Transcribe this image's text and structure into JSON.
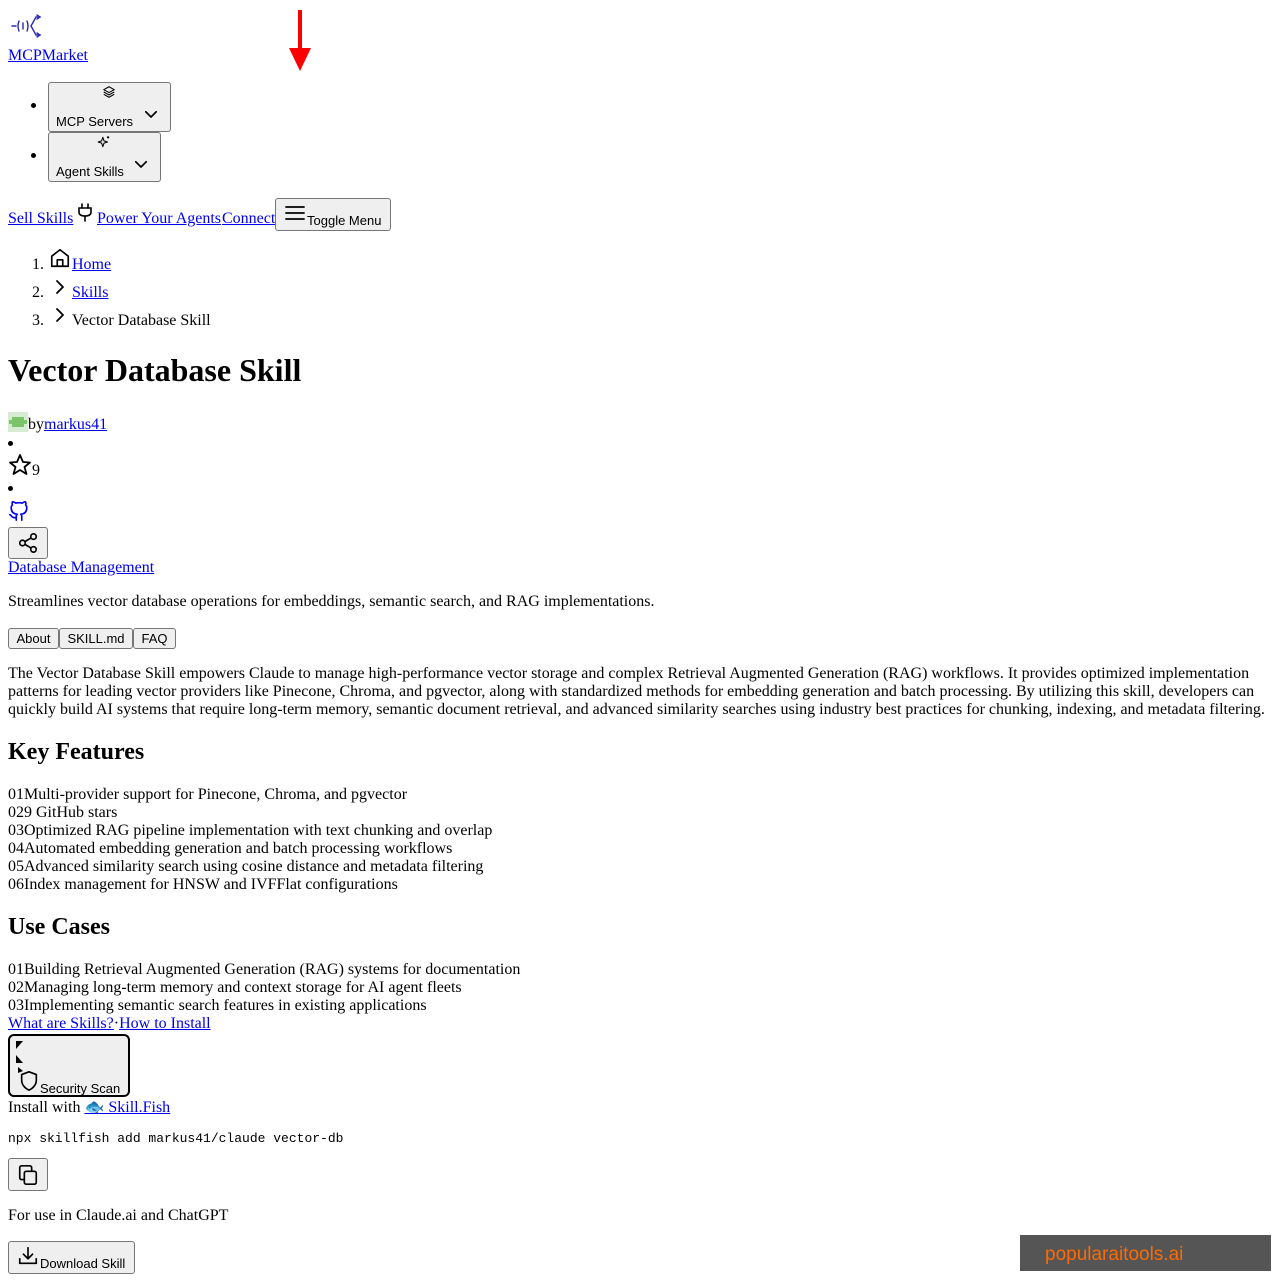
{
  "brand": {
    "name": "MCPMarket"
  },
  "nav": {
    "menus": [
      {
        "label": "MCP Servers",
        "icon": "layers-icon"
      },
      {
        "label": "Agent Skills",
        "icon": "sparkles-icon"
      }
    ],
    "sell_skills": "Sell Skills",
    "power_agents": "Power Your Agents",
    "connect": "Connect",
    "toggle_menu": "Toggle Menu"
  },
  "breadcrumb": {
    "items": [
      {
        "num": "1.",
        "label": "Home"
      },
      {
        "num": "2.",
        "label": "Skills"
      },
      {
        "num": "3.",
        "label": "Vector Database Skill"
      }
    ]
  },
  "page": {
    "title": "Vector Database Skill",
    "by": "by",
    "author": "markus41",
    "stars": "9",
    "category": "Database Management",
    "summary": "Streamlines vector database operations for embeddings, semantic search, and RAG implementations."
  },
  "tabs": [
    "About",
    "SKILL.md",
    "FAQ"
  ],
  "about": {
    "lines": [
      "The Vector Database Skill empowers Claude to manage high-performance vector storage and complex Retrieval Augmented Generation (RAG) workflows. It provides optimized implementation",
      "patterns for leading vector providers like Pinecone, Chroma, and pgvector, along with standardized methods for embedding generation and batch processing. By utilizing this skill, developers can",
      "quickly build AI systems that require long-term memory, semantic document retrieval, and advanced similarity searches using industry best practices for chunking, indexing, and metadata filtering."
    ]
  },
  "key_features": {
    "heading": "Key Features",
    "items": [
      {
        "num": "01",
        "text": "Multi-provider support for Pinecone, Chroma, and pgvector"
      },
      {
        "num": "02",
        "text": "9 GitHub stars"
      },
      {
        "num": "03",
        "text": "Optimized RAG pipeline implementation with text chunking and overlap"
      },
      {
        "num": "04",
        "text": "Automated embedding generation and batch processing workflows"
      },
      {
        "num": "05",
        "text": "Advanced similarity search using cosine distance and metadata filtering"
      },
      {
        "num": "06",
        "text": "Index management for HNSW and IVFFlat configurations"
      }
    ]
  },
  "use_cases": {
    "heading": "Use Cases",
    "items": [
      {
        "num": "01",
        "text": "Building Retrieval Augmented Generation (RAG) systems for documentation"
      },
      {
        "num": "02",
        "text": "Managing long-term memory and context storage for AI agent fleets"
      },
      {
        "num": "03",
        "text": "Implementing semantic search features in existing applications"
      }
    ]
  },
  "help_links": {
    "what": "What are Skills?",
    "sep": "·",
    "how": "How to Install"
  },
  "security_scan": "Security Scan",
  "install": {
    "prefix": "Install with ",
    "tool": "🐟 Skill.Fish",
    "command": "npx skillfish add markus41/claude vector-db"
  },
  "claude_use": "For use in Claude.ai and ChatGPT",
  "download": "Download Skill",
  "watermark": "popularaitools.ai",
  "colors": {
    "link": "#0000ee",
    "arrow": "#ff0000",
    "watermark_bg": "#555555",
    "watermark_text": "#ff6a00"
  }
}
